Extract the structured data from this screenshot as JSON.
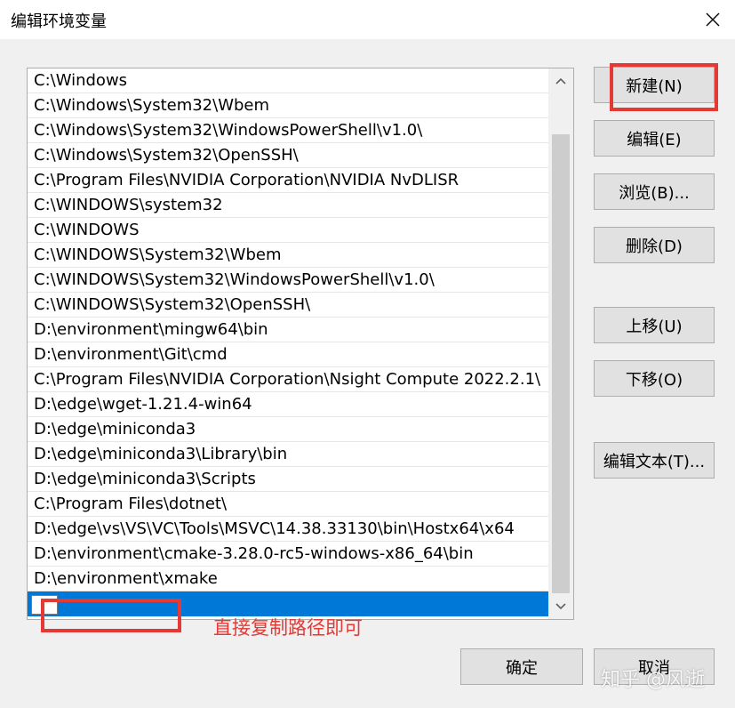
{
  "window": {
    "title": "编辑环境变量"
  },
  "path_list": {
    "items": [
      "C:\\Windows",
      "C:\\Windows\\System32\\Wbem",
      "C:\\Windows\\System32\\WindowsPowerShell\\v1.0\\",
      "C:\\Windows\\System32\\OpenSSH\\",
      "C:\\Program Files\\NVIDIA Corporation\\NVIDIA NvDLISR",
      "C:\\WINDOWS\\system32",
      "C:\\WINDOWS",
      "C:\\WINDOWS\\System32\\Wbem",
      "C:\\WINDOWS\\System32\\WindowsPowerShell\\v1.0\\",
      "C:\\WINDOWS\\System32\\OpenSSH\\",
      "D:\\environment\\mingw64\\bin",
      "D:\\environment\\Git\\cmd",
      "C:\\Program Files\\NVIDIA Corporation\\Nsight Compute 2022.2.1\\",
      "D:\\edge\\wget-1.21.4-win64",
      "D:\\edge\\miniconda3",
      "D:\\edge\\miniconda3\\Library\\bin",
      "D:\\edge\\miniconda3\\Scripts",
      "C:\\Program Files\\dotnet\\",
      "D:\\edge\\vs\\VS\\VC\\Tools\\MSVC\\14.38.33130\\bin\\Hostx64\\x64",
      "D:\\environment\\cmake-3.28.0-rc5-windows-x86_64\\bin",
      "D:\\environment\\xmake"
    ],
    "new_entry_value": ""
  },
  "buttons": {
    "new": "新建(N)",
    "edit": "编辑(E)",
    "browse": "浏览(B)...",
    "delete": "删除(D)",
    "move_up": "上移(U)",
    "move_down": "下移(O)",
    "edit_text": "编辑文本(T)...",
    "ok": "确定",
    "cancel": "取消"
  },
  "annotation": {
    "text": "直接复制路径即可",
    "color": "#e53935"
  },
  "watermark": {
    "text": "知乎 @风逝"
  },
  "colors": {
    "selection": "#0078d7",
    "highlight_box": "#e53935",
    "dialog_bg": "#f0f0f0"
  },
  "icons": {
    "close": "close-icon",
    "scroll_up": "chevron-up-icon",
    "scroll_down": "chevron-down-icon"
  }
}
